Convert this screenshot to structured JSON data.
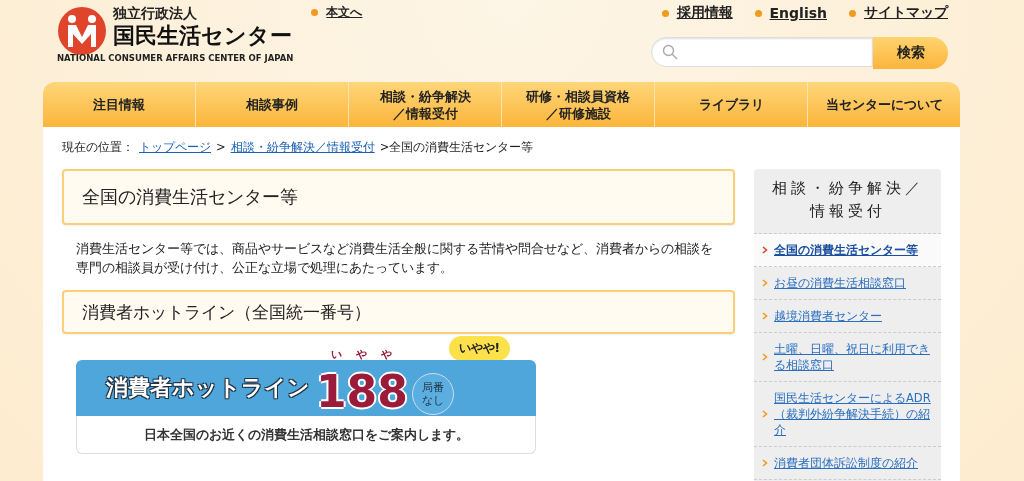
{
  "header": {
    "logo": {
      "subtitle": "独立行政法人",
      "title": "国民生活センター",
      "english": "NATIONAL CONSUMER AFFAIRS CENTER OF JAPAN"
    },
    "skip_link": "本文へ",
    "utility_links": [
      "採用情報",
      "English",
      "サイトマップ"
    ],
    "search": {
      "button": "検索"
    }
  },
  "nav": [
    {
      "lines": [
        "注目情報"
      ],
      "selected": false
    },
    {
      "lines": [
        "相談事例"
      ],
      "selected": false
    },
    {
      "lines": [
        "相談・紛争解決",
        "／情報受付"
      ],
      "selected": false
    },
    {
      "lines": [
        "研修・相談員資格",
        "／研修施設"
      ],
      "selected": false
    },
    {
      "lines": [
        "ライブラリ"
      ],
      "selected": false
    },
    {
      "lines": [
        "当センターについて"
      ],
      "selected": false
    }
  ],
  "breadcrumb": [
    {
      "kind": "text",
      "text": "現在の位置："
    },
    {
      "kind": "link",
      "text": "トップページ"
    },
    {
      "kind": "text",
      "text": ">"
    },
    {
      "kind": "link",
      "text": "相談・紛争解決／情報受付"
    },
    {
      "kind": "text",
      "text": ">全国の消費生活センター等"
    }
  ],
  "page_title": "全国の消費生活センター等",
  "intro": "消費生活センター等では、商品やサービスなど消費生活全般に関する苦情や問合せなど、消費者からの相談を専門の相談員が受け付け、公正な立場で処理にあたっています。",
  "section_title": "消費者ホットライン（全国統一番号）",
  "banner": {
    "title": "消費者ホットライン",
    "number": "188",
    "ruby": [
      "い",
      "や",
      "や"
    ],
    "bubble": "いやや!",
    "badge": [
      "局番",
      "なし"
    ],
    "caption": "日本全国のお近くの消費生活相談窓口をご案内します。"
  },
  "sidebar": {
    "title": [
      "相談・紛争解決／",
      "情報受付"
    ],
    "items": [
      {
        "label": "全国の消費生活センター等",
        "selected": true
      },
      {
        "label": "お昼の消費生活相談窓口",
        "selected": false
      },
      {
        "label": "越境消費者センター",
        "selected": false
      },
      {
        "label": "土曜、日曜、祝日に利用できる相談窓口",
        "selected": false
      },
      {
        "label": "国民生活センターによるADR（裁判外紛争解決手続）の紹介",
        "selected": false
      },
      {
        "label": "消費者団体訴訟制度の紹介",
        "selected": false
      }
    ]
  }
}
